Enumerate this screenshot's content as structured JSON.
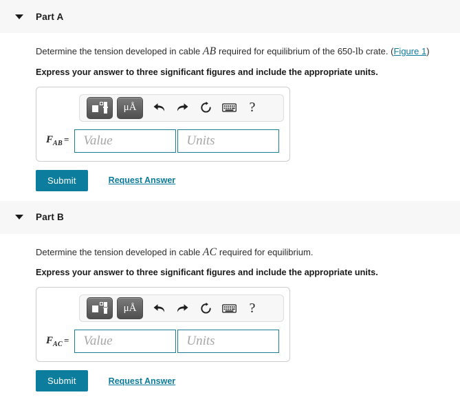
{
  "parts": [
    {
      "header_label": "Part A",
      "collapse_icon": "triangle-down-icon",
      "prompt_pre": "Determine the tension developed in cable ",
      "prompt_var": "AB",
      "prompt_mid": " required for equilibrium of the 650-",
      "prompt_unit": "lb",
      "prompt_post": " crate. ",
      "figure_link": "Figure 1",
      "has_figure_link": true,
      "instruction": "Express your answer to three significant figures and include the appropriate units.",
      "toolbar": {
        "template_button": "math-template-button",
        "units_button": "μÅ",
        "undo_icon": "undo-icon",
        "redo_icon": "redo-icon",
        "reset_icon": "reset-icon",
        "keyboard_icon": "keyboard-icon",
        "help_icon": "?"
      },
      "field_symbol": "F",
      "field_subscript": "AB",
      "field_equals": "=",
      "value_placeholder": "Value",
      "units_placeholder": "Units",
      "value_current": "",
      "units_current": "",
      "submit_label": "Submit",
      "request_answer_label": "Request Answer"
    },
    {
      "header_label": "Part B",
      "collapse_icon": "triangle-down-icon",
      "prompt_pre": "Determine the tension developed in cable ",
      "prompt_var": "AC",
      "prompt_mid": " required for equilibrium.",
      "prompt_unit": "",
      "prompt_post": "",
      "figure_link": "",
      "has_figure_link": false,
      "instruction": "Express your answer to three significant figures and include the appropriate units.",
      "toolbar": {
        "template_button": "math-template-button",
        "units_button": "μÅ",
        "undo_icon": "undo-icon",
        "redo_icon": "redo-icon",
        "reset_icon": "reset-icon",
        "keyboard_icon": "keyboard-icon",
        "help_icon": "?"
      },
      "field_symbol": "F",
      "field_subscript": "AC",
      "field_equals": "=",
      "value_placeholder": "Value",
      "units_placeholder": "Units",
      "value_current": "",
      "units_current": "",
      "submit_label": "Submit",
      "request_answer_label": "Request Answer"
    }
  ],
  "colors": {
    "accent_teal": "#0d7d9d",
    "link_teal": "#0c7b9b",
    "input_border": "#1b7a96",
    "header_band": "#f7f7f7",
    "box_border": "#cccccc"
  }
}
